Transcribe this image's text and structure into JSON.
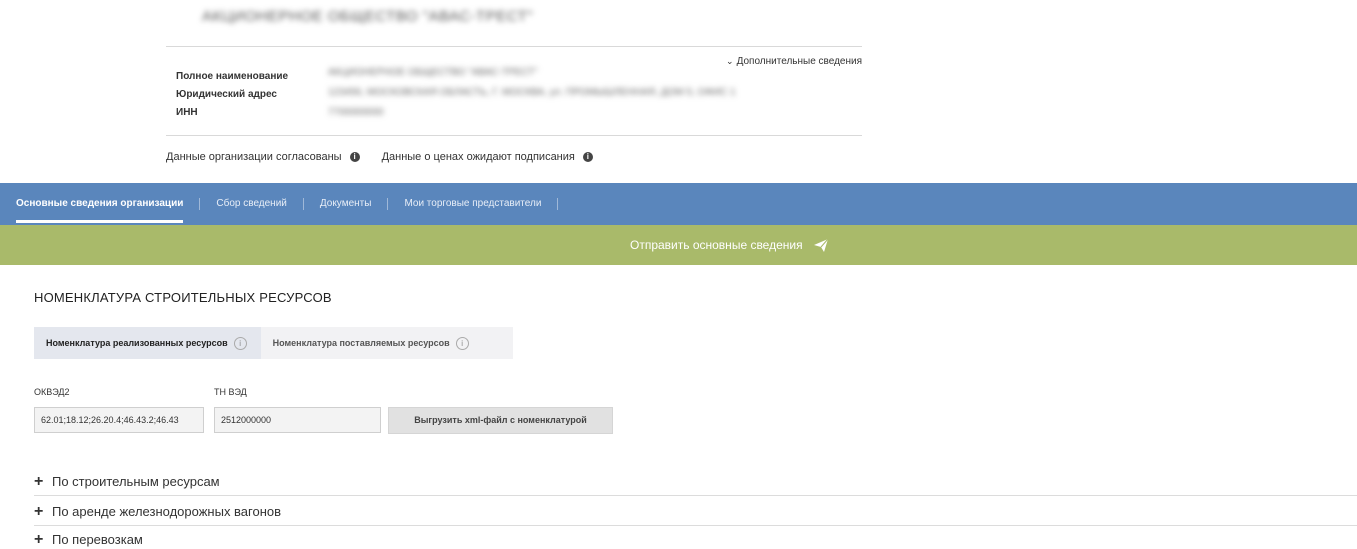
{
  "org": {
    "title": "АКЦИОНЕРНОЕ ОБЩЕСТВО \"АВАС-ТРЕСТ\"",
    "more_link": "Дополнительные сведения",
    "rows": [
      {
        "label": "Полное наименование",
        "value": "АКЦИОНЕРНОЕ ОБЩЕСТВО \"АВАС-ТРЕСТ\""
      },
      {
        "label": "Юридический адрес",
        "value": "123456, МОСКОВСКАЯ ОБЛАСТЬ, Г. МОСКВА, ул. ПРОМЫШЛЕННАЯ, ДОМ 5, ОФИС 1"
      },
      {
        "label": "ИНН",
        "value": "7700000000"
      }
    ],
    "status_1": "Данные организации согласованы",
    "status_2": "Данные о ценах ожидают подписания"
  },
  "nav": {
    "items": [
      "Основные сведения организации",
      "Сбор сведений",
      "Документы",
      "Мои торговые представители"
    ]
  },
  "send_button": "Отправить основные сведения",
  "section": {
    "title": "НОМЕНКЛАТУРА СТРОИТЕЛЬНЫХ РЕСУРСОВ",
    "tabs": [
      "Номенклатура реализованных ресурсов",
      "Номенклатура поставляемых ресурсов"
    ],
    "info_glyph": "i"
  },
  "fields": {
    "okved_label": "ОКВЭД2",
    "okved_value": "62.01;18.12;26.20.4;46.43.2;46.43",
    "tnved_label": "ТН ВЭД",
    "tnved_value": "2512000000",
    "export_button": "Выгрузить xml-файл с номенклатурой"
  },
  "accordion": [
    "По строительным ресурсам",
    "По аренде железнодорожных вагонов",
    "По перевозкам"
  ],
  "colors": {
    "nav_bg": "#5a86bc",
    "send_bg": "#a9ba6a"
  }
}
